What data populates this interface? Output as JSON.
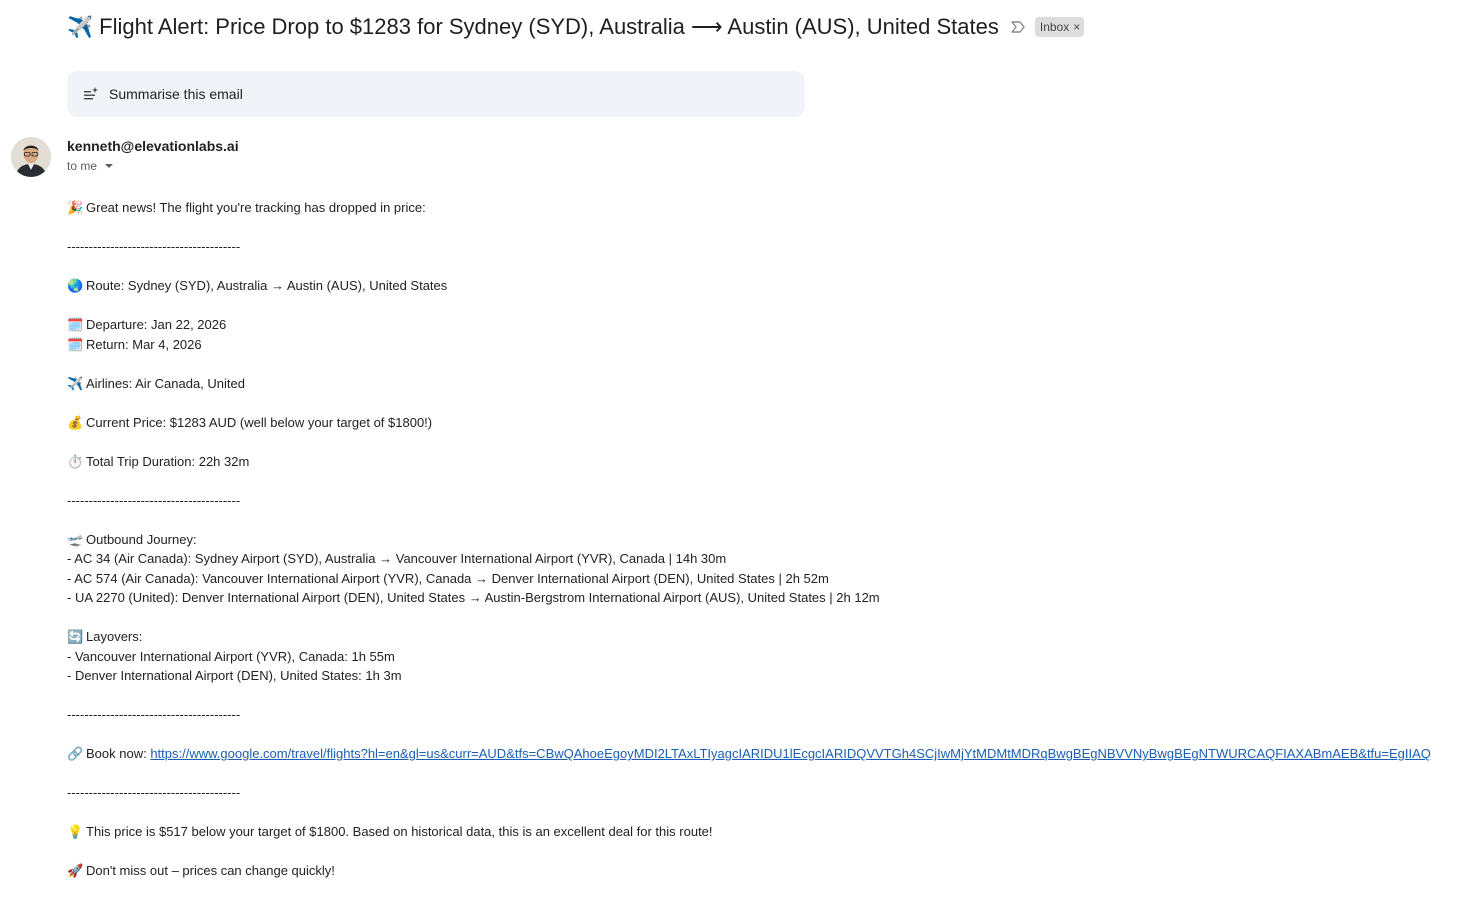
{
  "email": {
    "subject": "Flight Alert: Price Drop to $1283 for Sydney (SYD), Australia ⟶ Austin (AUS), United States",
    "subject_icon": "✈️",
    "label": "Inbox",
    "label_remove": "×",
    "summarise_label": "Summarise this email",
    "sender": "kenneth@elevationlabs.ai",
    "recipient": "to me"
  },
  "body": {
    "intro": "Great news! The flight you're tracking has dropped in price:",
    "divider": "----------------------------------------",
    "route": "Route: Sydney (SYD), Australia → Austin (AUS), United States",
    "departure": "Departure: Jan 22, 2026",
    "return": "Return: Mar 4, 2026",
    "airlines": "Airlines: Air Canada, United",
    "price": "Current Price: $1283 AUD (well below your target of $1800!)",
    "duration": "Total Trip Duration: 22h 32m",
    "outbound_title": "Outbound Journey:",
    "outbound": [
      "- AC 34 (Air Canada): Sydney Airport (SYD), Australia → Vancouver International Airport (YVR), Canada | 14h 30m",
      "- AC 574 (Air Canada): Vancouver International Airport (YVR), Canada → Denver International Airport (DEN), United States | 2h 52m",
      "- UA 2270 (United): Denver International Airport (DEN), United States → Austin-Bergstrom International Airport (AUS), United States | 2h 12m"
    ],
    "layovers_title": "Layovers:",
    "layovers": [
      "- Vancouver International Airport (YVR), Canada: 1h 55m",
      "- Denver International Airport (DEN), United States: 1h 3m"
    ],
    "book_label": "Book now:",
    "book_url": "https://www.google.com/travel/flights?hl=en&gl=us&curr=AUD&tfs=CBwQAhoeEgoyMDI2LTAxLTIyagcIARIDU1lEcgcIARIDQVVTGh4SCjIwMjYtMDMtMDRqBwgBEgNBVVNyBwgBEgNTWURCAQFIAXABmAEB&tfu=EgIIAQ",
    "tip": "This price is $517 below your target of $1800. Based on historical data, this is an excellent deal for this route!",
    "cta": "Don't miss out – prices can change quickly!",
    "emojis": {
      "party": "🎉",
      "globe": "🌏",
      "calendar": "🗓️",
      "plane": "✈️",
      "money": "💰",
      "timer": "⏱️",
      "departure": "🛫",
      "cycle": "🔄",
      "link": "🔗",
      "bulb": "💡",
      "rocket": "🚀"
    }
  }
}
